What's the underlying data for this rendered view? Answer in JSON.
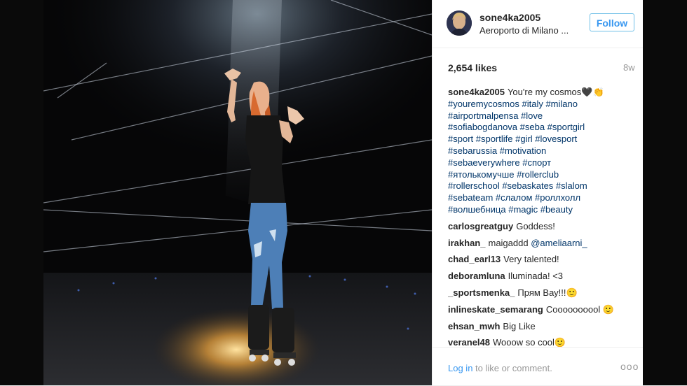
{
  "post": {
    "username": "sone4ka2005",
    "location": "Aeroporto di Milano ...",
    "follow_label": "Follow",
    "likes": "2,654 likes",
    "age": "8w",
    "caption_user": "sone4ka2005",
    "caption_text": "You're my cosmos🖤👏",
    "hashtag_lines": [
      "#youremycosmos #italy #milano",
      "#airportmalpensa #love",
      "#sofiabogdanova #seba #sportgirl",
      "#sport #sportlife #girl #lovesport",
      "#sebarussia #motivation",
      "#sebaeverywhere #спорт",
      "#ятолькомучше #rollerclub",
      "#rollerschool #sebaskates #slalom",
      "#sebateam #слалом #роллхолл",
      "#волшебница #magic #beauty"
    ],
    "comments": [
      {
        "user": "carlosgreatguy",
        "text": "Goddess!"
      },
      {
        "user": "irakhan_",
        "text": "maigaddd",
        "mention": "@ameliaarni_"
      },
      {
        "user": "chad_earl13",
        "text": "Very talented!"
      },
      {
        "user": "deboramluna",
        "text": "Iluminada! <3"
      },
      {
        "user": "_sportsmenka_",
        "text": "Прям Вау!!!🙂"
      },
      {
        "user": "inlineskate_semarang",
        "text": "Coooooooool 🙂"
      },
      {
        "user": "ehsan_mwh",
        "text": "Big Like"
      },
      {
        "user": "veranel48",
        "text": "Wooow so cool🙂"
      }
    ],
    "login_link": "Log in",
    "login_rest": " to like or comment.",
    "more_label": "ooo"
  },
  "icons": {
    "more": "more-options-icon"
  },
  "colors": {
    "link_blue": "#3897f0",
    "hashtag": "#003569",
    "follow_border": "#70c0e7"
  }
}
